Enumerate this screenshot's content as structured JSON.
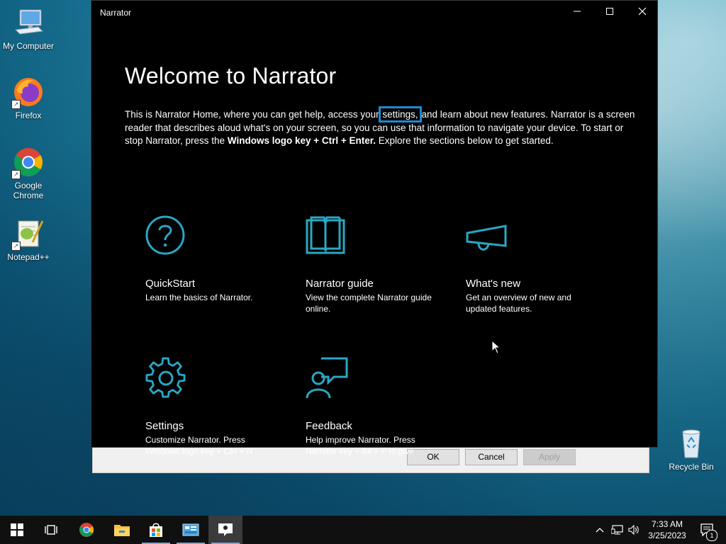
{
  "desktop": {
    "icons": [
      {
        "label": "My Computer",
        "icon": "computer-icon"
      },
      {
        "label": "Firefox",
        "icon": "firefox-icon"
      },
      {
        "label": "Google Chrome",
        "icon": "chrome-icon"
      },
      {
        "label": "Notepad++",
        "icon": "notepadpp-icon"
      },
      {
        "label": "Recycle Bin",
        "icon": "recycle-bin-icon"
      }
    ]
  },
  "back_dialog": {
    "ok_label": "OK",
    "cancel_label": "Cancel",
    "apply_label": "Apply"
  },
  "window": {
    "title": "Narrator",
    "minimize": "—",
    "maximize": "☐",
    "close": "✕",
    "heading": "Welcome to Narrator",
    "intro": {
      "part1": "This is Narrator Home, where you can get help, access your ",
      "settings_link": "settings,",
      "part2": " and learn about new features. Narrator is a screen reader that describes aloud what's on your screen, so you can use that information to navigate your device. To start or stop Narrator, press the ",
      "shortcut": "Windows logo key + Ctrl + Enter.",
      "part3": " Explore the sections below to get started."
    },
    "tiles": [
      {
        "name": "QuickStart",
        "desc": "Learn the basics of Narrator.",
        "icon": "question-circle-icon"
      },
      {
        "name": "Narrator guide",
        "desc": "View the complete Narrator guide online.",
        "icon": "book-icon"
      },
      {
        "name": "What's new",
        "desc": "Get an overview of new and updated features.",
        "icon": "megaphone-icon"
      },
      {
        "name": "Settings",
        "desc": "Customize Narrator. Press Windows logo key + Ctrl + N",
        "icon": "gear-icon"
      },
      {
        "name": "Feedback",
        "desc": "Help improve Narrator. Press Narrator key + Alt + F to give",
        "icon": "feedback-icon"
      }
    ]
  },
  "taskbar": {
    "items": [
      "start-icon",
      "task-view-icon",
      "chrome-icon",
      "file-explorer-icon",
      "store-icon",
      "control-panel-icon",
      "narrator-icon"
    ],
    "time": "7:33 AM",
    "date": "3/25/2023",
    "notification_count": "1"
  },
  "colors": {
    "accent": "#2aa7c4",
    "focus_outline": "#1e8ad2"
  }
}
